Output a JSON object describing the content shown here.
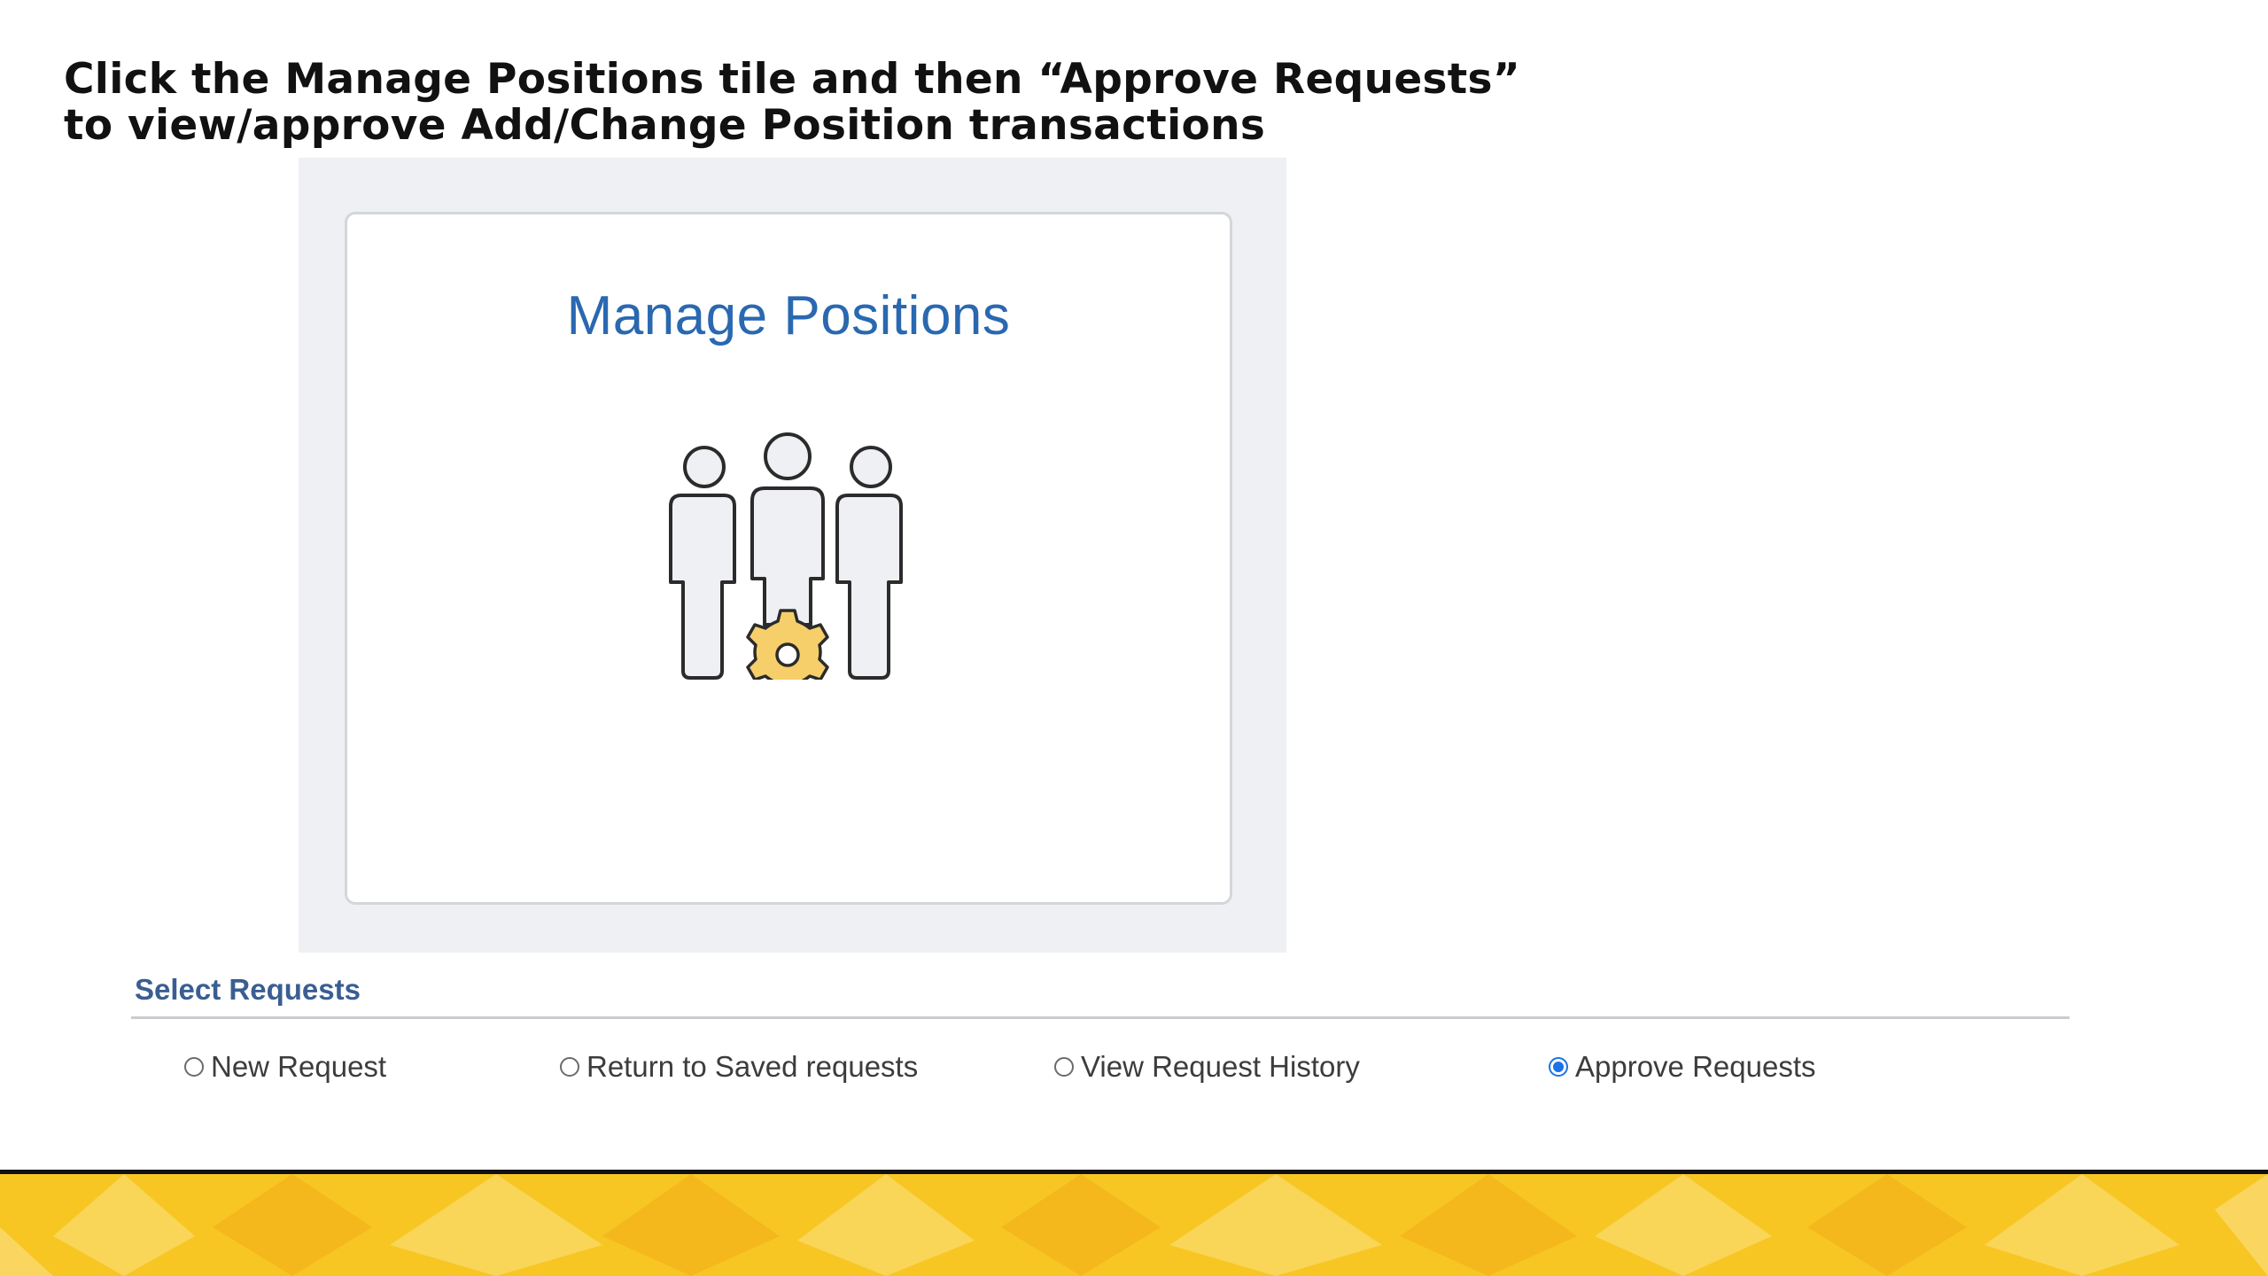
{
  "slide": {
    "heading_line1": "Click the Manage Positions tile and then “Approve Requests”",
    "heading_line2": "to view/approve Add/Change Position transactions"
  },
  "tile": {
    "title": "Manage Positions",
    "icon": "people-gear-icon",
    "title_color": "#2a68b0",
    "gear_color": "#f6cf6a"
  },
  "select_requests": {
    "title": "Select Requests",
    "options": [
      {
        "label": "New Request",
        "checked": false
      },
      {
        "label": "Return to Saved requests",
        "checked": false
      },
      {
        "label": "View Request History",
        "checked": false
      },
      {
        "label": "Approve Requests",
        "checked": true
      }
    ]
  },
  "footer": {
    "colors": [
      "#f7c623",
      "#f9d558",
      "#f4b81d"
    ]
  }
}
